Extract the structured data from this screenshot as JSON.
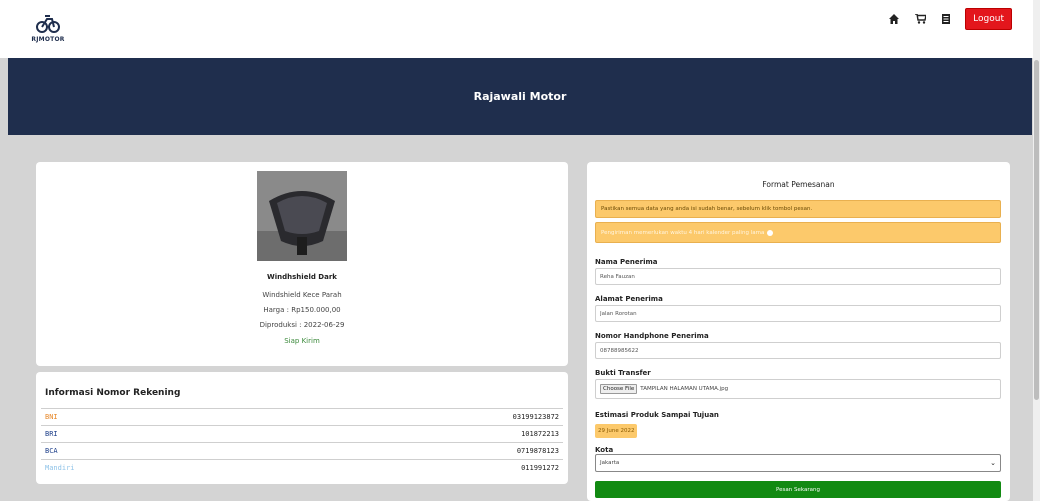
{
  "nav": {
    "logo_text": "RJMOTOR",
    "home_icon": "home-icon",
    "cart_icon": "cart-icon",
    "orders_icon": "document-icon",
    "logout_label": "Logout"
  },
  "banner": {
    "title": "Rajawali Motor"
  },
  "product": {
    "name": "Windhshield Dark",
    "description": "Windshield Kece Parah",
    "price": "Harga : Rp150.000,00",
    "production_date": "Diproduksi : 2022-06-29",
    "status": "Siap Kirim"
  },
  "rekening": {
    "title": "Informasi Nomor Rekening",
    "rows": [
      {
        "bank": "BNI",
        "number": "03199123872",
        "color": "#e8892b"
      },
      {
        "bank": "BRI",
        "number": "101872213",
        "color": "#1d3f8a"
      },
      {
        "bank": "BCA",
        "number": "0719878123",
        "color": "#1d3f8a"
      },
      {
        "bank": "Mandiri",
        "number": "011991272",
        "color": "#8fc3e8"
      }
    ]
  },
  "order": {
    "title": "Format Pemesanan",
    "alert_confirm": "Pastikan semua data yang anda isi sudah benar, sebelum klik tombol pesan.",
    "alert_shipping": "Pengiriman memerlukan waktu 4 hari kalender paling lama",
    "nama_label": "Nama Penerima",
    "nama_value": "Reha Fauzan",
    "alamat_label": "Alamat Penerima",
    "alamat_value": "Jalan Rorotan",
    "hp_label": "Nomor Handphone Penerima",
    "hp_value": "08788985622",
    "bukti_label": "Bukti Transfer",
    "choose_file_label": "Choose File",
    "file_name": "TAMPILAN HALAMAN UTAMA.jpg",
    "estimasi_label": "Estimasi Produk Sampai Tujuan",
    "estimasi_value": "29 June 2022",
    "kota_label": "Kota",
    "kota_value": "Jakarta",
    "submit_label": "Pesan Sekarang"
  },
  "colors": {
    "navy": "#1f2e4d",
    "logout_red": "#e3161c",
    "alert_yellow": "#fcc96b",
    "submit_green": "#128a12",
    "status_green": "#3c8a3c"
  }
}
